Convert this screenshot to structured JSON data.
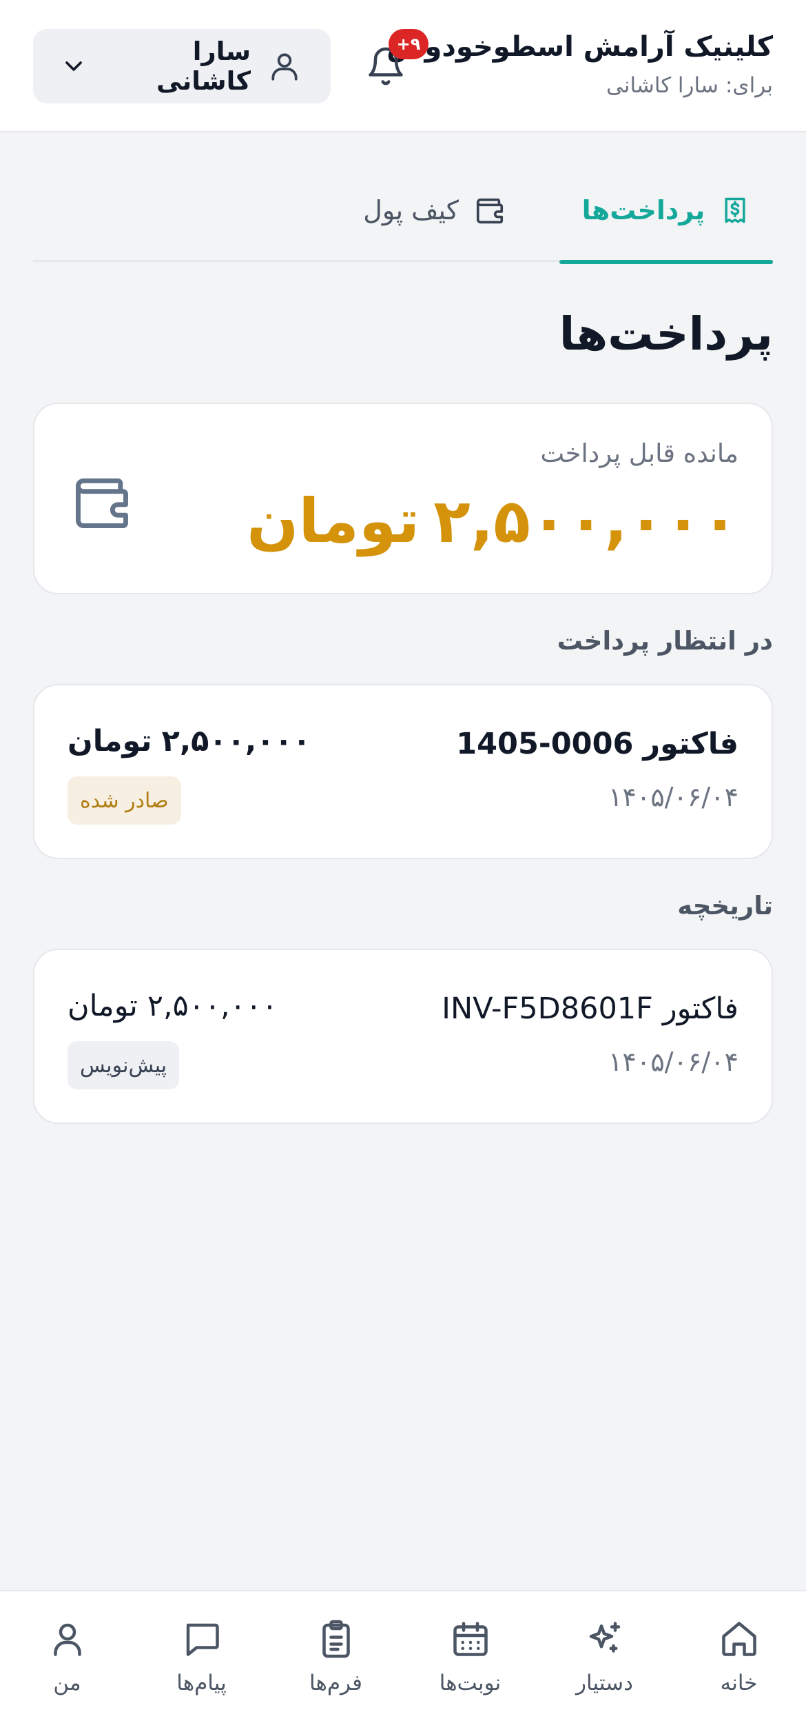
{
  "header": {
    "clinic_name": "کلینیک آرامش اسطوخودوس",
    "for_label": "برای:",
    "for_value": "سارا کاشانی",
    "notifications_badge": "۹+",
    "user_select": {
      "name": "سارا کاشانی",
      "icon": "user-icon",
      "chevron": "chevron-down-icon"
    }
  },
  "tabs": [
    {
      "label": "پرداخت‌ها",
      "icon": "receipt-dollar-icon",
      "active": true
    },
    {
      "label": "کیف پول",
      "icon": "wallet-icon",
      "active": false
    }
  ],
  "page": {
    "title": "پرداخت‌ها"
  },
  "balance": {
    "label": "مانده قابل پرداخت",
    "amount": "۲,۵۰۰,۰۰۰",
    "unit": "تومان",
    "icon": "wallet-icon",
    "color": "#d4930b"
  },
  "pending": {
    "title": "در انتظار پرداخت",
    "items": [
      {
        "prefix": "فاکتور",
        "number": "1405-0006",
        "date": "۱۴۰۵/۰۶/۰۴",
        "amount": "۲,۵۰۰,۰۰۰",
        "unit": "تومان",
        "status": "صادر شده"
      }
    ]
  },
  "history": {
    "title": "تاریخچه",
    "items": [
      {
        "prefix": "فاکتور",
        "number": "INV-F5D8601F",
        "date": "۱۴۰۵/۰۶/۰۴",
        "amount": "۲,۵۰۰,۰۰۰",
        "unit": "تومان",
        "status": "پیش‌نویس"
      }
    ]
  },
  "nav": [
    {
      "label": "خانه",
      "icon": "home-icon"
    },
    {
      "label": "دستیار",
      "icon": "sparkles-icon"
    },
    {
      "label": "نوبت‌ها",
      "icon": "calendar-icon"
    },
    {
      "label": "فرم‌ها",
      "icon": "clipboard-icon"
    },
    {
      "label": "پیام‌ها",
      "icon": "message-icon"
    },
    {
      "label": "من",
      "icon": "user-icon"
    }
  ],
  "colors": {
    "accent": "#14a89b",
    "amount": "#d4930b",
    "badge": "#dc2626"
  }
}
